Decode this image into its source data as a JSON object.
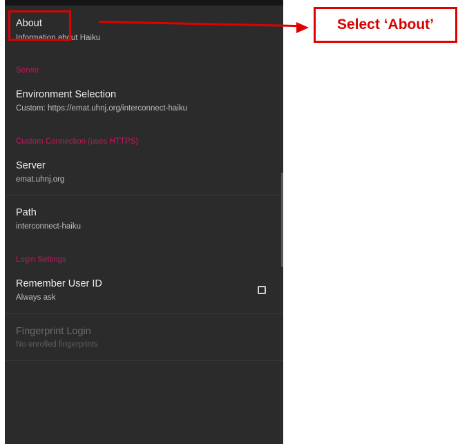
{
  "about": {
    "title": "About",
    "subtitle": "Information about Haiku"
  },
  "server_section": {
    "header": "Server",
    "environment": {
      "title": "Environment Selection",
      "subtitle": "Custom: https://emat.uhnj.org/interconnect-haiku"
    }
  },
  "custom_connection": {
    "header": "Custom Connection (uses HTTPS)",
    "server": {
      "title": "Server",
      "subtitle": "emat.uhnj.org"
    },
    "path": {
      "title": "Path",
      "subtitle": "interconnect-haiku"
    }
  },
  "login_settings": {
    "header": "Login Settings",
    "remember": {
      "title": "Remember User ID",
      "subtitle": "Always ask",
      "checked": false
    },
    "fingerprint": {
      "title": "Fingerprint Login",
      "subtitle": "No enrolled fingerprints",
      "enabled": false
    }
  },
  "annotation": {
    "callout": "Select ‘About’"
  },
  "colors": {
    "background": "#2b2b2c",
    "category": "#c2185b",
    "annotation": "#e00000"
  }
}
